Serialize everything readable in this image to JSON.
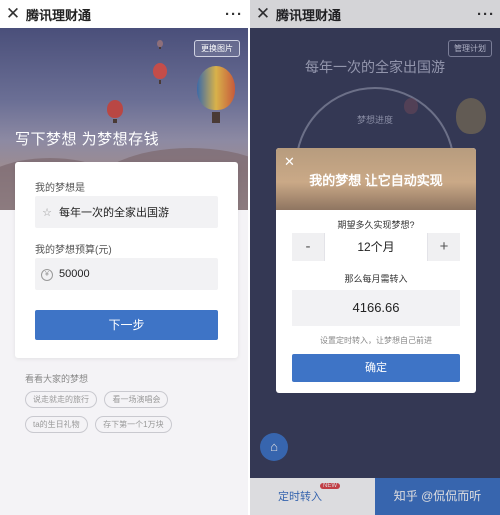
{
  "left": {
    "titlebar": {
      "close": "✕",
      "title": "腾讯理财通",
      "more": "···"
    },
    "hero": {
      "change_image": "更换图片",
      "headline": "写下梦想 为梦想存钱"
    },
    "card": {
      "dream_label": "我的梦想是",
      "dream_icon": "star-icon",
      "dream_value": "每年一次的全家出国游",
      "budget_label": "我的梦想预算(元)",
      "budget_icon": "yuan-coin-icon",
      "budget_value": "50000",
      "next_button": "下一步"
    },
    "others": {
      "label": "看看大家的梦想",
      "tags": [
        "说走就走的旅行",
        "看一场演唱会",
        "ta的生日礼物",
        "存下第一个1万块"
      ]
    }
  },
  "right": {
    "titlebar": {
      "close": "✕",
      "title": "腾讯理财通",
      "more": "···"
    },
    "manage_button": "管理计划",
    "plan_title": "每年一次的全家出国游",
    "progress_label": "梦想进度",
    "dialog": {
      "close": "✕",
      "title": "我的梦想 让它自动实现",
      "question": "期望多久实现梦想?",
      "minus": "-",
      "months": "12个月",
      "plus": "+",
      "monthly_label": "那么每月需转入",
      "monthly_amount": "4166.66",
      "hint": "设置定时转入，让梦想自己前进",
      "confirm": "确定"
    },
    "bottom": {
      "timed_transfer": "定时转入",
      "badge": "NEW",
      "watermark": "知乎 @侃侃而听",
      "home_icon": "home-icon"
    },
    "colors": {
      "accent": "#3e74c6"
    }
  }
}
